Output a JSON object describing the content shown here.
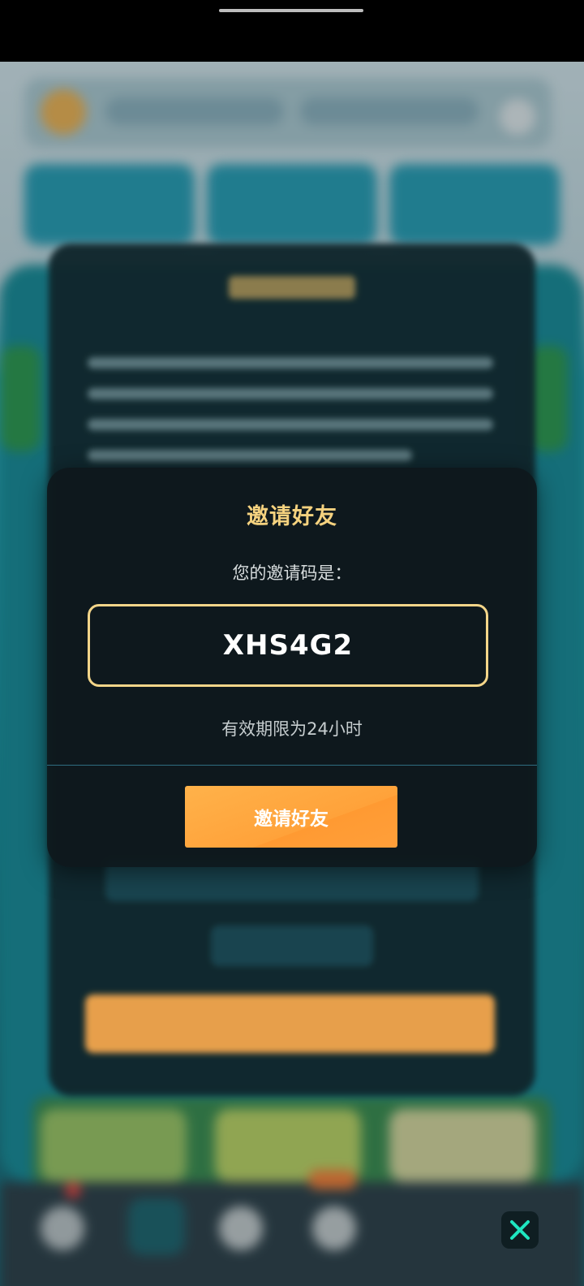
{
  "invite_dialog": {
    "title": "邀请好友",
    "prompt": "您的邀请码是：",
    "invite_code": "XHS4G2",
    "validity_note": "有效期限为24小时",
    "invite_button_label": "邀请好友"
  },
  "close_button": {
    "icon": "close-x-icon",
    "accent_color": "#1ee6c0"
  },
  "colors": {
    "title_gold": "#f5d27f",
    "code_border": "#f3d589",
    "button_orange": "#ffa23a",
    "dialog_background": "#0e181c"
  }
}
